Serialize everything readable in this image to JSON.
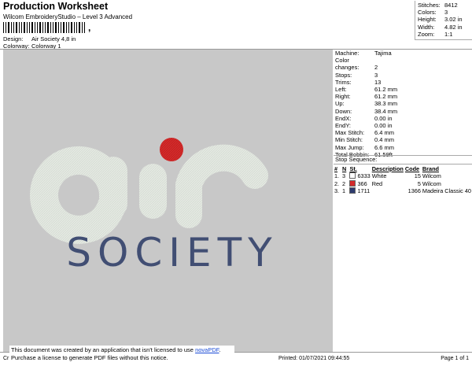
{
  "header": {
    "title": "Production Worksheet",
    "subtitle": "Wilcom EmbroideryStudio – Level 3 Advanced",
    "barcode_suffix": ",",
    "design_label": "Design:",
    "design_value": "Air Society 4,8 in",
    "colorway_label": "Colorway:",
    "colorway_value": "Colorway 1"
  },
  "summary": [
    {
      "label": "Stitches:",
      "value": "8412"
    },
    {
      "label": "Colors:",
      "value": "3"
    },
    {
      "label": "Height:",
      "value": "3.02 in"
    },
    {
      "label": "Width:",
      "value": "4.82 in"
    },
    {
      "label": "Zoom:",
      "value": "1:1"
    }
  ],
  "machine_specs": [
    {
      "label": "Machine:",
      "value": "Tajima"
    },
    {
      "label": "Color changes:",
      "value": "2"
    },
    {
      "label": "Stops:",
      "value": "3"
    },
    {
      "label": "Trims:",
      "value": "13"
    },
    {
      "label": "Left:",
      "value": "61.2 mm"
    },
    {
      "label": "Right:",
      "value": "61.2 mm"
    },
    {
      "label": "Up:",
      "value": "38.3 mm"
    },
    {
      "label": "Down:",
      "value": "38.4 mm"
    },
    {
      "label": "EndX:",
      "value": "0.00 in"
    },
    {
      "label": "EndY:",
      "value": "0.00 in"
    },
    {
      "label": "Max Stitch:",
      "value": "6.4 mm"
    },
    {
      "label": "Min Stitch:",
      "value": "0.4 mm"
    },
    {
      "label": "Max Jump:",
      "value": "6.6 mm"
    },
    {
      "label": "Total Bobbin:",
      "value": "61.59ft"
    }
  ],
  "stop_sequence": {
    "title": "Stop Sequence:",
    "headers": [
      "#",
      "N",
      "St.",
      "Description",
      "Code",
      "Brand"
    ],
    "rows": [
      {
        "num": "1.",
        "n": "3",
        "color": "#ffffff",
        "st": "6333",
        "desc": "White",
        "code": "15",
        "brand": "Wilcom"
      },
      {
        "num": "2.",
        "n": "2",
        "color": "#d42a2a",
        "st": "366",
        "desc": "Red",
        "code": "5",
        "brand": "Wilcom"
      },
      {
        "num": "3.",
        "n": "1",
        "color": "#2e3b6e",
        "st": "1711",
        "desc": "",
        "code": "1366",
        "brand": "Madeira Classic 40"
      }
    ]
  },
  "logo": {
    "word_top": "air",
    "word_bottom": "SOCIETY",
    "colors": {
      "white_thread": "#e4e9e2",
      "red_thread": "#d42a2a",
      "navy_thread": "#414e73",
      "background": "#c8c8c8"
    }
  },
  "footer": {
    "left_text": "Cr",
    "printed": "Printed: 01/07/2021 09:44:55",
    "page": "Page 1 of 1"
  },
  "notice": {
    "line1_pre": "This document was created by an application that isn't licensed to use ",
    "link": "novaPDF",
    "line1_post": ".",
    "line2": "Purchase a license to generate PDF files without this notice."
  }
}
